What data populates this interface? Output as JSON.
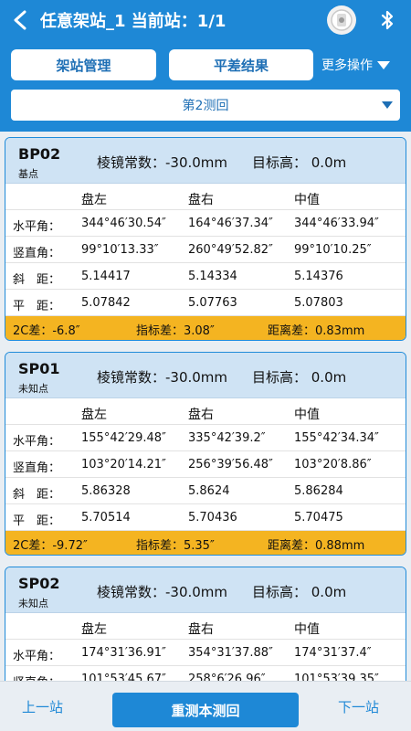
{
  "header": {
    "title": "任意架站_1  当前站：1/1"
  },
  "toolbar": {
    "station_mgmt": "架站管理",
    "adjust_result": "平差结果",
    "more": "更多操作",
    "round_select": "第2测回"
  },
  "table_header": [
    "盘左",
    "盘右",
    "中值"
  ],
  "cards": [
    {
      "name": "BP02",
      "type": "基点",
      "prism": "棱镜常数：-30.0mm",
      "target": "目标高：  0.0m",
      "rows": [
        {
          "label": "水平角：",
          "left": "344°46′30.54″",
          "right": "164°46′37.34″",
          "mid": "344°46′33.94″"
        },
        {
          "label": "竖直角：",
          "left": "99°10′13.33″",
          "right": "260°49′52.82″",
          "mid": "99°10′10.25″"
        },
        {
          "label": "斜　距：",
          "left": "5.14417",
          "right": "5.14334",
          "mid": "5.14376"
        },
        {
          "label": "平　距：",
          "left": "5.07842",
          "right": "5.07763",
          "mid": "5.07803"
        }
      ],
      "footer": {
        "c2": "2C差：-6.8″",
        "index": "指标差：3.08″",
        "dist": "距离差：0.83mm"
      }
    },
    {
      "name": "SP01",
      "type": "未知点",
      "prism": "棱镜常数：-30.0mm",
      "target": "目标高：  0.0m",
      "rows": [
        {
          "label": "水平角：",
          "left": "155°42′29.48″",
          "right": "335°42′39.2″",
          "mid": "155°42′34.34″"
        },
        {
          "label": "竖直角：",
          "left": "103°20′14.21″",
          "right": "256°39′56.48″",
          "mid": "103°20′8.86″"
        },
        {
          "label": "斜　距：",
          "left": "5.86328",
          "right": "5.8624",
          "mid": "5.86284"
        },
        {
          "label": "平　距：",
          "left": "5.70514",
          "right": "5.70436",
          "mid": "5.70475"
        }
      ],
      "footer": {
        "c2": "2C差：-9.72″",
        "index": "指标差：5.35″",
        "dist": "距离差：0.88mm"
      }
    },
    {
      "name": "SP02",
      "type": "未知点",
      "prism": "棱镜常数：-30.0mm",
      "target": "目标高：  0.0m",
      "rows": [
        {
          "label": "水平角：",
          "left": "174°31′36.91″",
          "right": "354°31′37.88″",
          "mid": "174°31′37.4″"
        },
        {
          "label": "竖直角：",
          "left": "101°53′45.67″",
          "right": "258°6′26.96″",
          "mid": "101°53′39.35″"
        }
      ]
    }
  ],
  "bottom": {
    "prev": "上一站",
    "retest": "重测本测回",
    "next": "下一站"
  },
  "icons": {
    "back": "chevron-left-icon",
    "device": "total-station-icon",
    "bluetooth": "bluetooth-icon"
  },
  "colors": {
    "primary": "#1e88d6",
    "card_header": "#cfe3f4",
    "footer_highlight": "#f4b421"
  }
}
